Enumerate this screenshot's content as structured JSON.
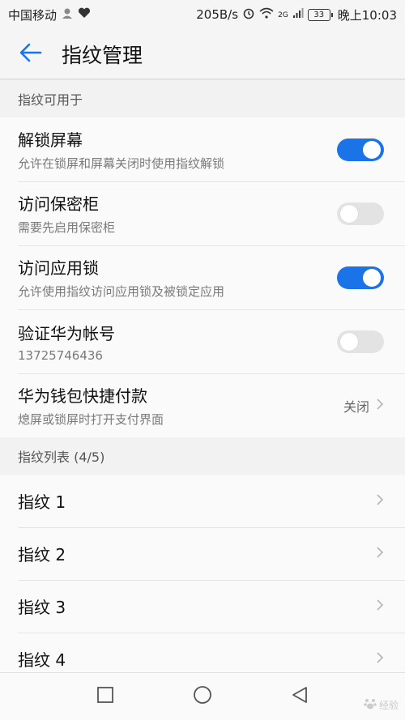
{
  "statusbar": {
    "carrier": "中国移动",
    "net_speed": "205B/s",
    "network_type": "2G",
    "battery": "33",
    "time": "晚上10:03",
    "icons": [
      "avatar-icon",
      "heart-icon",
      "alarm-icon",
      "wifi-icon",
      "signal-icon",
      "battery-icon"
    ]
  },
  "appbar": {
    "title": "指纹管理",
    "back_icon": "arrow-left-icon"
  },
  "section_usage": {
    "header": "指纹可用于",
    "items": [
      {
        "title": "解锁屏幕",
        "subtitle": "允许在锁屏和屏幕关闭时使用指纹解锁",
        "toggle": "on"
      },
      {
        "title": "访问保密柜",
        "subtitle": "需要先启用保密柜",
        "toggle": "off"
      },
      {
        "title": "访问应用锁",
        "subtitle": "允许使用指纹访问应用锁及被锁定应用",
        "toggle": "on"
      },
      {
        "title": "验证华为帐号",
        "subtitle": "13725746436",
        "toggle": "off"
      },
      {
        "title": "华为钱包快捷付款",
        "subtitle": "熄屏或锁屏时打开支付界面",
        "value": "关闭"
      }
    ]
  },
  "section_list": {
    "header": "指纹列表 (4/5)",
    "items": [
      {
        "title": "指纹 1"
      },
      {
        "title": "指纹 2"
      },
      {
        "title": "指纹 3"
      },
      {
        "title": "指纹 4"
      }
    ]
  },
  "navbar": {
    "icons": [
      "recent-apps-icon",
      "home-icon",
      "back-icon"
    ]
  },
  "watermark": {
    "text": "经验"
  },
  "colors": {
    "accent": "#1a74e8",
    "toggle_off": "#e3e3e3",
    "background": "#f2f2f2",
    "card": "#fafafa"
  }
}
